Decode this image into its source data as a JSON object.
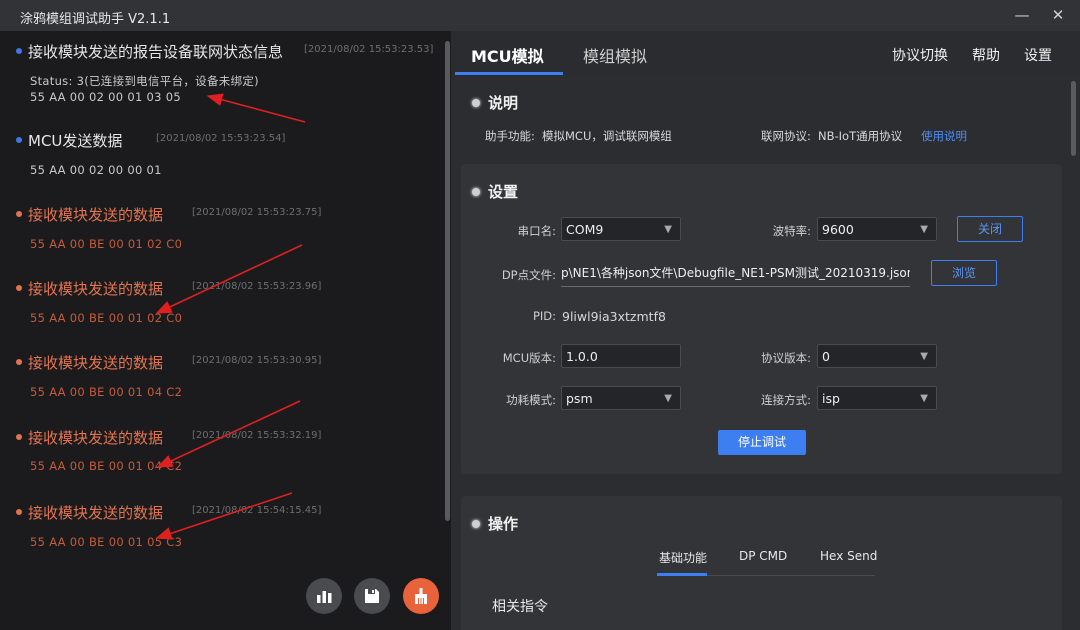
{
  "window": {
    "title": "涂鸦模组调试助手 V2.1.1",
    "minimize": "—",
    "close": "✕"
  },
  "log": [
    {
      "title": "接收模块发送的报告设备联网状态信息",
      "time": "[2021/08/02 15:53:23.53]",
      "status": "Status: 3(已连接到电信平台，设备未绑定)",
      "hex": "55 AA 00 02 00 01 03 05",
      "color": "blue"
    },
    {
      "title": "MCU发送数据",
      "time": "[2021/08/02 15:53:23.54]",
      "hex": "55 AA 00 02 00 00 01",
      "color": "blue"
    },
    {
      "title": "接收模块发送的数据",
      "time": "[2021/08/02 15:53:23.75]",
      "hex": "55 AA 00 BE 00 01 02 C0",
      "color": "orange"
    },
    {
      "title": "接收模块发送的数据",
      "time": "[2021/08/02 15:53:23.96]",
      "hex": "55 AA 00 BE 00 01 02 C0",
      "color": "orange"
    },
    {
      "title": "接收模块发送的数据",
      "time": "[2021/08/02 15:53:30.95]",
      "hex": "55 AA 00 BE 00 01 04 C2",
      "color": "orange"
    },
    {
      "title": "接收模块发送的数据",
      "time": "[2021/08/02 15:53:32.19]",
      "hex": "55 AA 00 BE 00 01 04 C2",
      "color": "orange"
    },
    {
      "title": "接收模块发送的数据",
      "time": "[2021/08/02 15:54:15.45]",
      "hex": "55 AA 00 BE 00 01 05 C3",
      "color": "orange"
    }
  ],
  "tabs": {
    "mcu": "MCU模拟",
    "module": "模组模拟"
  },
  "top_links": {
    "switch": "协议切换",
    "help": "帮助",
    "settings": "设置"
  },
  "desc": {
    "title": "说明",
    "func_label": "助手功能:",
    "func_value": "模拟MCU，调试联网模组",
    "proto_label": "联网协议:",
    "proto_value": "NB-IoT通用协议",
    "usage_link": "使用说明"
  },
  "settings": {
    "title": "设置",
    "port_label": "串口名:",
    "port_value": "COM9",
    "baud_label": "波特率:",
    "baud_value": "9600",
    "close_button": "关闭",
    "dp_label": "DP点文件:",
    "dp_value": "p\\NE1\\各种json文件\\Debugfile_NE1-PSM测试_20210319.json",
    "browse_button": "浏览",
    "pid_label": "PID:",
    "pid_value": "9liwl9ia3xtzmtf8",
    "mcu_ver_label": "MCU版本:",
    "mcu_ver_value": "1.0.0",
    "proto_ver_label": "协议版本:",
    "proto_ver_value": "0",
    "power_label": "功耗模式:",
    "power_value": "psm",
    "conn_label": "连接方式:",
    "conn_value": "isp",
    "stop_button": "停止调试"
  },
  "ops": {
    "title": "操作",
    "tab_basic": "基础功能",
    "tab_dp": "DP CMD",
    "tab_hex": "Hex Send",
    "related": "相关指令"
  }
}
